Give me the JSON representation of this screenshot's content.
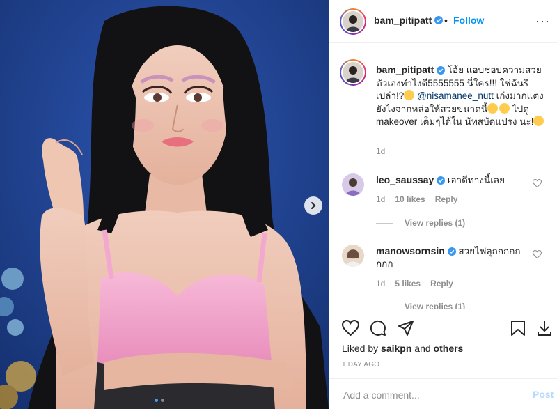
{
  "post": {
    "username": "bam_pitipatt",
    "verified": true,
    "follow_label": "Follow",
    "separator": "•",
    "more_label": "···"
  },
  "caption": {
    "username": "bam_pitipatt",
    "text_part1": "โอ้ย แอบชอบความสวยตัวเองทำไงดี5555555 นี่ใคร!!! ใช่ฉันรึเปล่า!?",
    "mention": "@nisamanee_nutt",
    "text_part2": "เก่งมากแต่งยังไงจากหล่อให้สวยขนาดนี้",
    "text_part3": "ไปดู makeover เต็มๆได้ใน นัทสบัดแปรง นะ!",
    "age": "1d"
  },
  "comments": [
    {
      "username": "leo_saussay",
      "verified": true,
      "text": "เอาดีทางนี้เลย",
      "age": "1d",
      "likes": "10 likes",
      "reply_label": "Reply",
      "view_replies": "View replies (1)"
    },
    {
      "username": "manowsornsin",
      "verified": true,
      "text": "สวยไฟลุกกกกกกกก",
      "age": "1d",
      "likes": "5 likes",
      "reply_label": "Reply",
      "view_replies": "View replies (1)"
    }
  ],
  "actions": {
    "liked_by_prefix": "Liked by",
    "liked_by_user": "saikpn",
    "liked_by_and": "and",
    "liked_by_others": "others",
    "timestamp": "1 DAY AGO"
  },
  "add_comment": {
    "placeholder": "Add a comment...",
    "post_label": "Post"
  },
  "carousel": {
    "total": 2,
    "active": 0
  },
  "colors": {
    "accent": "#0095f6",
    "verified": "#3897f0",
    "post_disabled": "#b3dbff",
    "meta": "#8e8e8e"
  }
}
